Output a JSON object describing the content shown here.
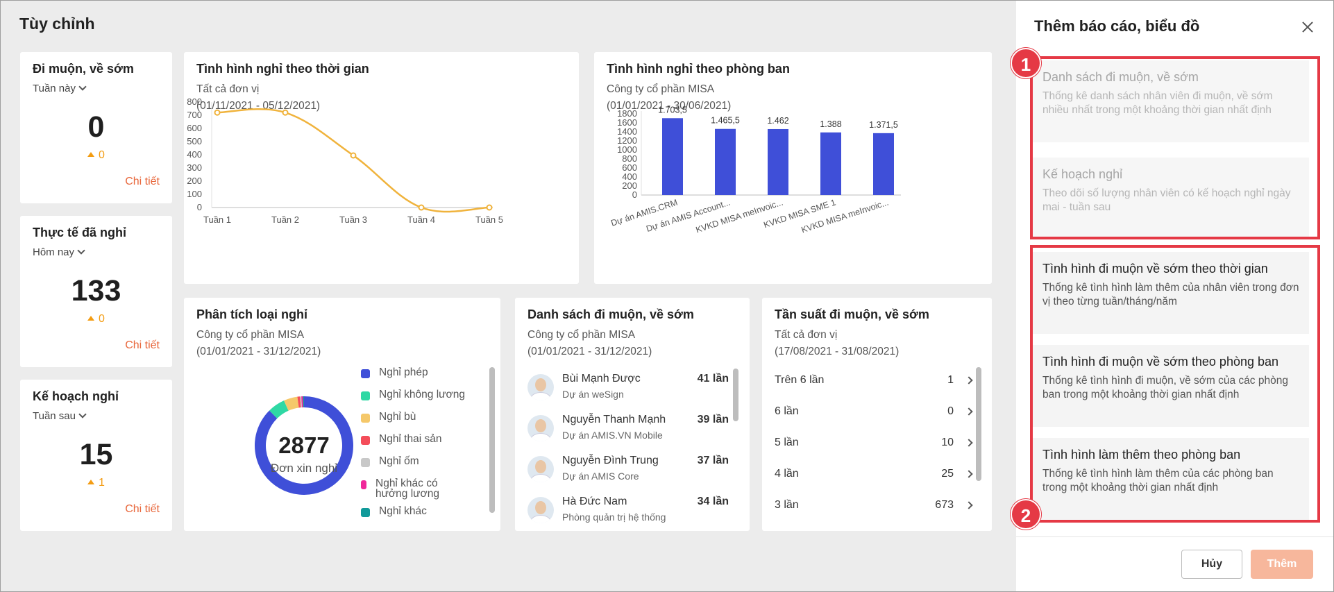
{
  "page": {
    "title": "Tùy chỉnh"
  },
  "stats": [
    {
      "title": "Đi muộn, về sớm",
      "period": "Tuần này",
      "value": "0",
      "delta": "0",
      "detail": "Chi tiết"
    },
    {
      "title": "Thực tế đã nghỉ",
      "period": "Hôm nay",
      "value": "133",
      "delta": "0",
      "detail": "Chi tiết"
    },
    {
      "title": "Kế hoạch nghỉ",
      "period": "Tuần sau",
      "value": "15",
      "delta": "1",
      "detail": "Chi tiết"
    }
  ],
  "leave_time": {
    "title": "Tình hình nghỉ theo thời gian",
    "unit": "Tất cả đơn vị",
    "range": "(01/11/2021 - 05/12/2021)"
  },
  "leave_dept": {
    "title": "Tình hình nghỉ theo phòng ban",
    "unit": "Công ty cổ phần MISA",
    "range": "(01/01/2021 - 30/06/2021)"
  },
  "leave_type": {
    "title": "Phân tích loại nghỉ",
    "unit": "Công ty cổ phần MISA",
    "range": "(01/01/2021 - 31/12/2021)",
    "total": "2877",
    "total_label": "Đơn xin nghỉ",
    "legend": [
      {
        "label": "Nghỉ phép",
        "color": "#3f4fd8"
      },
      {
        "label": "Nghỉ không lương",
        "color": "#2fd8a4"
      },
      {
        "label": "Nghỉ bù",
        "color": "#f5c86a"
      },
      {
        "label": "Nghỉ thai sản",
        "color": "#f44d5a"
      },
      {
        "label": "Nghỉ ốm",
        "color": "#c8c8c8"
      },
      {
        "label": "Nghỉ khác có hưởng lương",
        "color": "#f0289a"
      },
      {
        "label": "Nghỉ khác",
        "color": "#119a9a"
      }
    ]
  },
  "late_list": {
    "title": "Danh sách đi muộn, về sớm",
    "unit": "Công ty cổ phần MISA",
    "range": "(01/01/2021 - 31/12/2021)",
    "rows": [
      {
        "name": "Bùi Mạnh Được",
        "dept": "Dự án weSign",
        "count": "41 lần"
      },
      {
        "name": "Nguyễn Thanh Mạnh",
        "dept": "Dự án AMIS.VN Mobile",
        "count": "39 lần"
      },
      {
        "name": "Nguyễn Đình Trung",
        "dept": "Dự án AMIS Core",
        "count": "37 lần"
      },
      {
        "name": "Hà Đức Nam",
        "dept": "Phòng quản trị hệ thống",
        "count": "34 lần"
      }
    ]
  },
  "late_freq": {
    "title": "Tần suất đi muộn, về sớm",
    "unit": "Tất cả đơn vị",
    "range": "(17/08/2021 - 31/08/2021)",
    "rows": [
      {
        "label": "Trên 6 lần",
        "value": "1"
      },
      {
        "label": "6 lần",
        "value": "0"
      },
      {
        "label": "5 lần",
        "value": "10"
      },
      {
        "label": "4 lần",
        "value": "25"
      },
      {
        "label": "3 lần",
        "value": "673"
      }
    ]
  },
  "panel": {
    "title": "Thêm báo cáo, biểu đồ",
    "options": [
      {
        "title": "Danh sách đi muộn, về sớm",
        "desc": "Thống kê danh sách nhân viên đi muộn, về sớm nhiều nhất trong một khoảng thời gian nhất định",
        "enabled": false
      },
      {
        "title": "Kế hoạch nghỉ",
        "desc": "Theo dõi số lượng nhân viên có kế hoạch nghỉ ngày mai - tuần sau",
        "enabled": false
      },
      {
        "title": "Tình hình đi muộn về sớm theo thời gian",
        "desc": "Thống kê tình hình làm thêm của nhân viên trong đơn vị theo từng tuần/tháng/năm",
        "enabled": true
      },
      {
        "title": "Tình hình đi muộn về sớm theo phòng ban",
        "desc": "Thống kê tình hình đi muộn, về sớm của các phòng ban trong một khoảng thời gian nhất định",
        "enabled": true
      },
      {
        "title": "Tình hình làm thêm theo phòng ban",
        "desc": "Thống kê tình hình làm thêm của các phòng ban trong một khoảng thời gian nhất định",
        "enabled": true
      }
    ],
    "markers": [
      "1",
      "2"
    ],
    "cancel_label": "Hủy",
    "add_label": "Thêm"
  },
  "chart_data": [
    {
      "type": "line",
      "title": "Tình hình nghỉ theo thời gian",
      "categories": [
        "Tuần 1",
        "Tuần 2",
        "Tuần 3",
        "Tuần 4",
        "Tuần 5"
      ],
      "values": [
        720,
        720,
        395,
        0,
        0
      ],
      "yticks": [
        0,
        100,
        200,
        300,
        400,
        500,
        600,
        700,
        800
      ],
      "ylim": [
        0,
        800
      ],
      "color": "#f0b33c",
      "grid": false
    },
    {
      "type": "bar",
      "title": "Tình hình nghỉ theo phòng ban",
      "categories": [
        "Dự án AMIS.CRM",
        "Dự án AMIS Account...",
        "KVKD MISA meInvoic...",
        "KVKD MISA SME 1",
        "KVKD MISA meInvoic..."
      ],
      "values": [
        1703.5,
        1465.5,
        1462,
        1388,
        1371.5
      ],
      "labels": [
        "1.703,5",
        "1.465,5",
        "1.462",
        "1.388",
        "1.371,5"
      ],
      "yticks": [
        0,
        200,
        400,
        600,
        800,
        1000,
        1200,
        1400,
        1600,
        1800
      ],
      "ylim": [
        0,
        1800
      ],
      "color": "#3f4fd8",
      "grid": false
    },
    {
      "type": "pie",
      "title": "Phân tích loại nghỉ",
      "categories": [
        "Nghỉ phép",
        "Nghỉ không lương",
        "Nghỉ bù",
        "Nghỉ thai sản",
        "Nghỉ ốm",
        "Nghỉ khác có hưởng lương",
        "Nghỉ khác"
      ],
      "values": [
        2520,
        165,
        130,
        25,
        12,
        15,
        10
      ],
      "total": 2877,
      "donut": true
    }
  ]
}
